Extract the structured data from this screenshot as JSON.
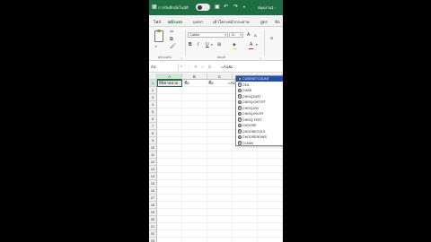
{
  "title_bar": {
    "autosave_label": "การบันทึกอัตโนมัติ",
    "file_name": "สมุดงาน1 -"
  },
  "ribbon_tabs": [
    {
      "label": "ไฟล์",
      "active": false
    },
    {
      "label": "หน้าแรก",
      "active": true
    },
    {
      "label": "แทรก",
      "active": false
    },
    {
      "label": "เค้าโครงหน้ากระดาษ",
      "active": false
    },
    {
      "label": "สูตร",
      "active": false
    },
    {
      "label": "ข้อ",
      "active": false
    }
  ],
  "ribbon": {
    "clipboard_label": "คลิปบอร์ด",
    "font_label": "ฟอนต์",
    "font_name": "Calibri",
    "font_size": "11",
    "grow_font": "A",
    "shrink_font": "A",
    "bold": "B",
    "italic": "I",
    "underline": "U",
    "font_color_letter": "A"
  },
  "formula_bar": {
    "name_box": "A1",
    "cancel_symbol": "✕",
    "enter_symbol": "✓",
    "fx_label": "fx",
    "formula": "=A1&c"
  },
  "grid": {
    "columns": [
      "A",
      "B",
      "C",
      "D",
      "E"
    ],
    "selected_column": "A",
    "rows": [
      "1",
      "2",
      "3",
      "4",
      "5",
      "6",
      "7",
      "8",
      "9",
      "10",
      "11",
      "12",
      "13",
      "14",
      "15",
      "16",
      "17",
      "18",
      "19",
      "20",
      "21",
      "22",
      "23"
    ],
    "selected_row": "1",
    "active_cell_text": "ลีนิชาหน่วย",
    "b1_text": "ชื่อ",
    "c1_text": "ชื่อ",
    "d1_text": "=A1&c"
  },
  "autocomplete": {
    "items": [
      {
        "label": "CUBESETCOUNT",
        "selected": true
      },
      {
        "label": "CEIL",
        "selected": false
      },
      {
        "label": "CHAR",
        "selected": false
      },
      {
        "label": "CHISQ.DIST",
        "selected": false
      },
      {
        "label": "CHISQ.DIST.RT",
        "selected": false
      },
      {
        "label": "CHISQ.INV",
        "selected": false
      },
      {
        "label": "CHISQ.INV.RT",
        "selected": false
      },
      {
        "label": "CHISQ.TEST",
        "selected": false
      },
      {
        "label": "CHOOSE",
        "selected": false
      },
      {
        "label": "CHOOSECOLS",
        "selected": false
      },
      {
        "label": "CHOOSEROWS",
        "selected": false
      },
      {
        "label": "CLEAN",
        "selected": false
      }
    ]
  },
  "colors": {
    "excel_green": "#1f6e43",
    "selection_blue": "#1f4fb4",
    "font_color_red": "#e02020"
  }
}
